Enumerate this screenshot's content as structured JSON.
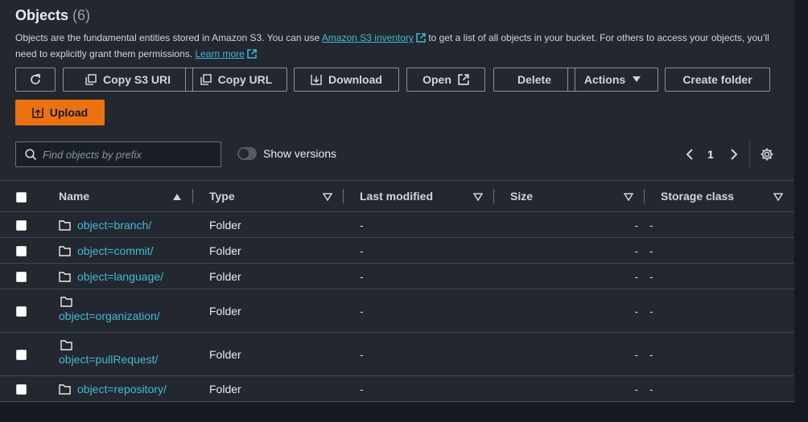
{
  "header": {
    "title": "Objects",
    "count": "(6)",
    "desc_part1": "Objects are the fundamental entities stored in Amazon S3. You can use ",
    "desc_link1": "Amazon S3 inventory",
    "desc_part2": " to get a list of all objects in your bucket. For others to access your objects, you’ll need to explicitly grant them permissions. ",
    "desc_link2": "Learn more"
  },
  "toolbar": {
    "copy_s3_uri": "Copy S3 URI",
    "copy_url": "Copy URL",
    "download": "Download",
    "open": "Open",
    "delete": "Delete",
    "actions": "Actions",
    "create_folder": "Create folder",
    "upload": "Upload"
  },
  "search": {
    "placeholder": "Find objects by prefix"
  },
  "versions": {
    "label": "Show versions"
  },
  "pagination": {
    "page": "1"
  },
  "table": {
    "headers": {
      "name": "Name",
      "type": "Type",
      "last_modified": "Last modified",
      "size": "Size",
      "storage_class": "Storage class"
    },
    "rows": [
      {
        "name": "object=branch/",
        "type": "Folder",
        "last_modified": "-",
        "size": "-",
        "storage_class": "-"
      },
      {
        "name": "object=commit/",
        "type": "Folder",
        "last_modified": "-",
        "size": "-",
        "storage_class": "-"
      },
      {
        "name": "object=language/",
        "type": "Folder",
        "last_modified": "-",
        "size": "-",
        "storage_class": "-"
      },
      {
        "name": "object=organization/",
        "type": "Folder",
        "last_modified": "-",
        "size": "-",
        "storage_class": "-"
      },
      {
        "name": "object=pullRequest/",
        "type": "Folder",
        "last_modified": "-",
        "size": "-",
        "storage_class": "-"
      },
      {
        "name": "object=repository/",
        "type": "Folder",
        "last_modified": "-",
        "size": "-",
        "storage_class": "-"
      }
    ]
  },
  "colors": {
    "accent": "#ec7211",
    "link": "#44b9d6",
    "panel": "#232730",
    "background": "#16191f"
  }
}
